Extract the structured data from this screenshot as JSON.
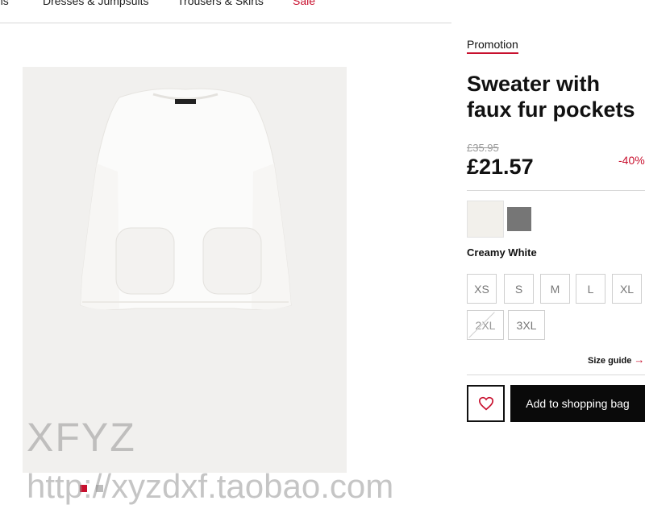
{
  "nav": {
    "items": [
      {
        "label": "ns"
      },
      {
        "label": "Dresses & Jumpsuits"
      },
      {
        "label": "Trousers & Skirts"
      },
      {
        "label": "Sale"
      }
    ]
  },
  "product": {
    "badge": "Promotion",
    "title": "Sweater with faux fur pockets",
    "old_price": "£35.95",
    "price": "£21.57",
    "discount": "-40%",
    "colors": [
      {
        "name": "Creamy White",
        "hex": "#f2f0eb",
        "selected": true
      },
      {
        "name": "Grey",
        "hex": "#767676",
        "selected": false
      }
    ],
    "selected_color_label": "Creamy White",
    "sizes": [
      {
        "label": "XS",
        "available": true
      },
      {
        "label": "S",
        "available": true
      },
      {
        "label": "M",
        "available": true
      },
      {
        "label": "L",
        "available": true
      },
      {
        "label": "XL",
        "available": true
      },
      {
        "label": "2XL",
        "available": false
      },
      {
        "label": "3XL",
        "available": true
      }
    ],
    "size_guide_label": "Size guide",
    "size_guide_arrow": "→",
    "wishlist_icon": "heart-icon",
    "add_to_bag_label": "Add to shopping bag"
  },
  "gallery": {
    "image_count": 2,
    "active_index": 0
  },
  "watermark": {
    "line1": "XFYZ",
    "line2": "http://xyzdxf.taobao.com"
  },
  "colors": {
    "accent": "#c8102e",
    "button_bg": "#0a0a0a"
  }
}
